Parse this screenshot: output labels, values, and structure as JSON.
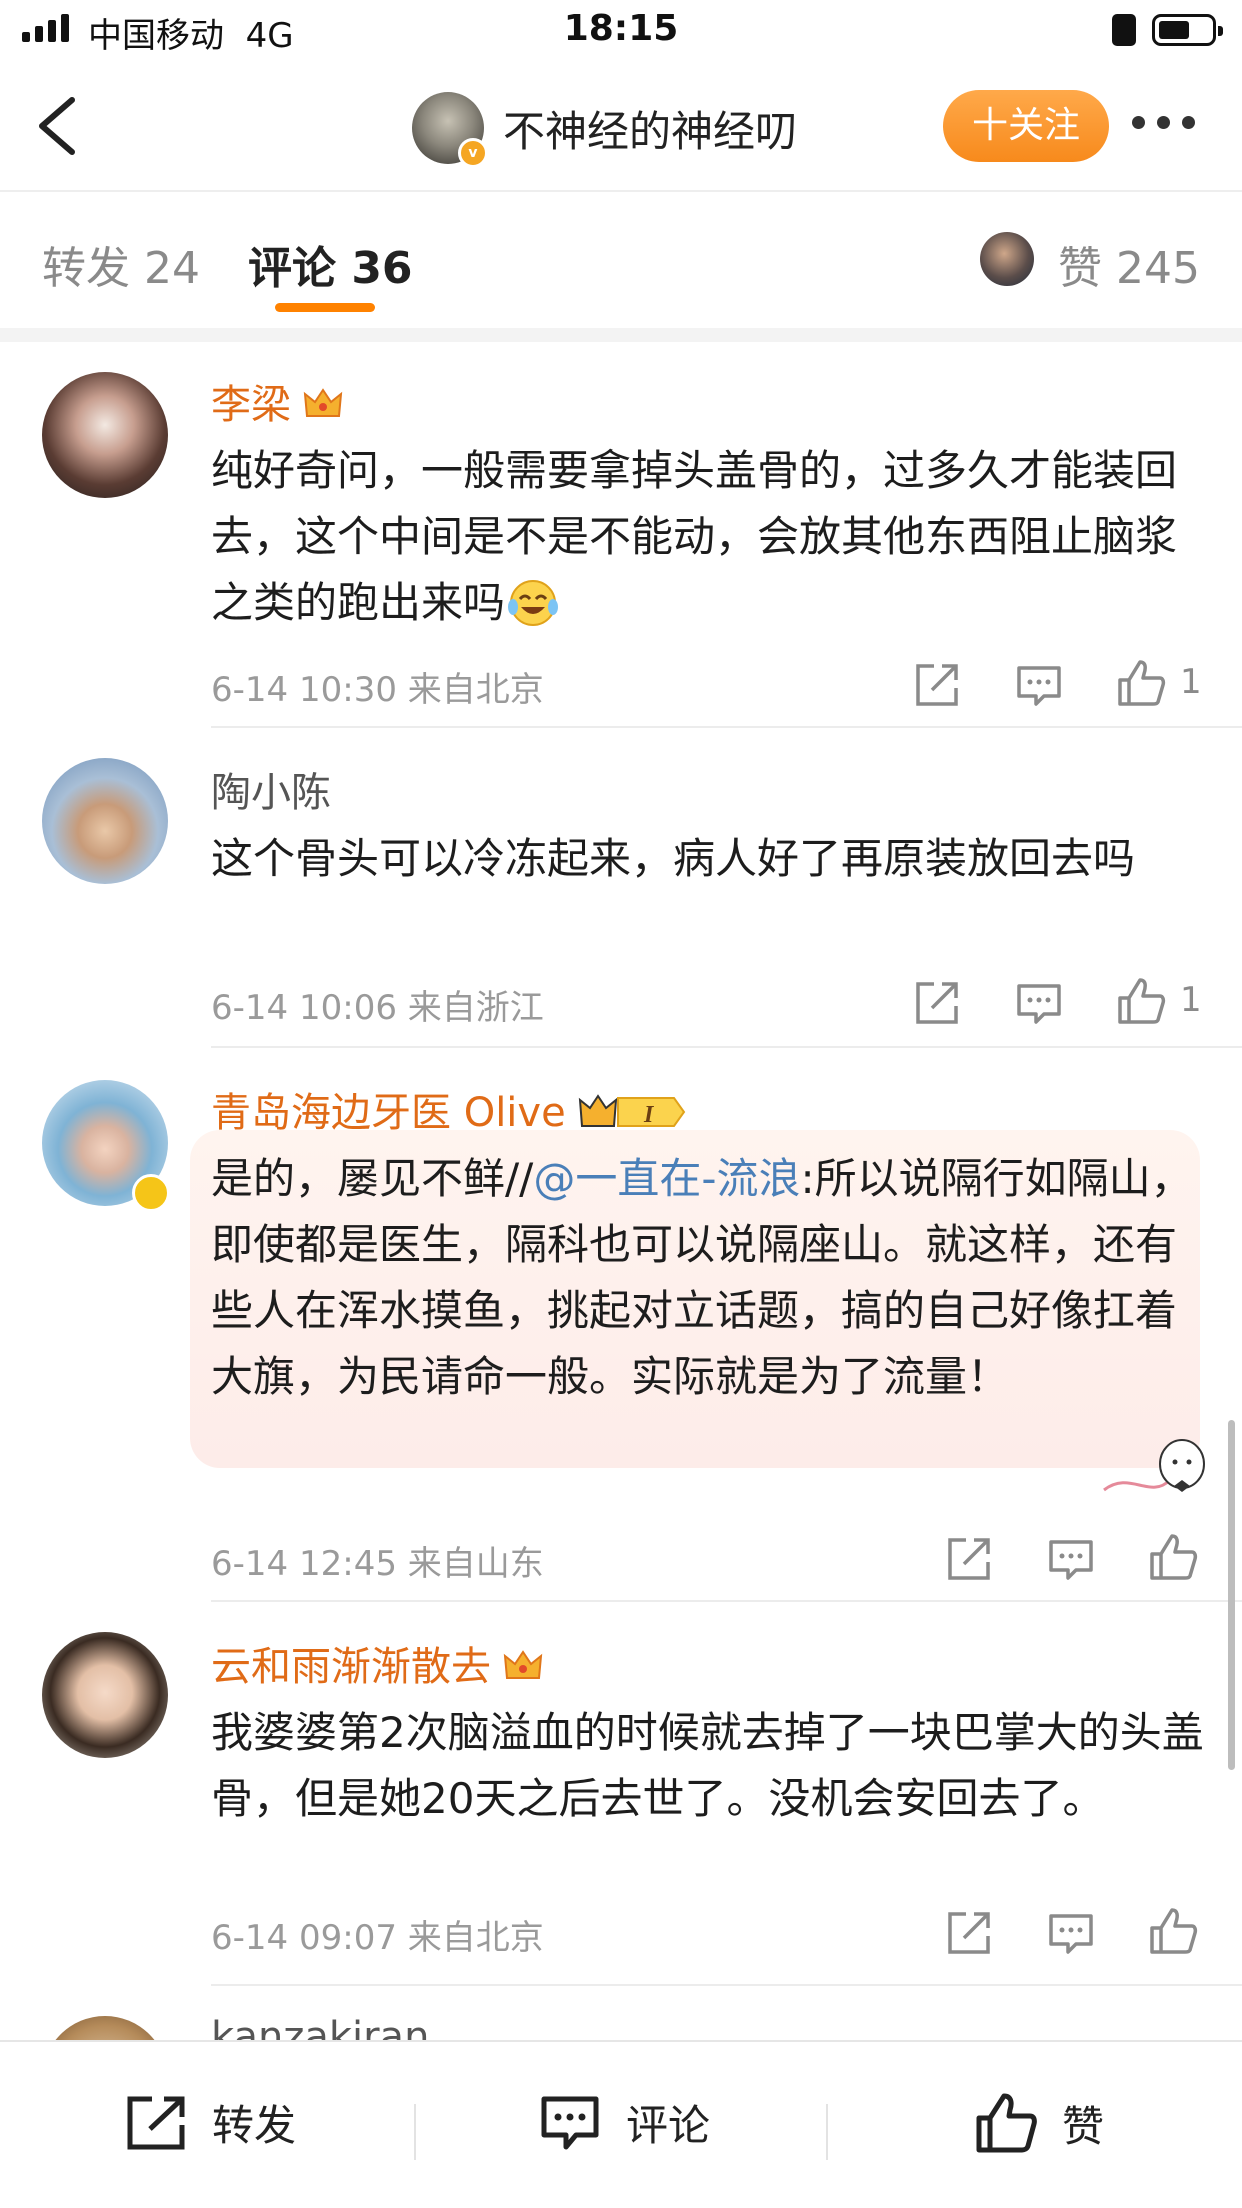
{
  "status_bar": {
    "carrier": "中国移动",
    "network": "4G",
    "time": "18:15"
  },
  "nav": {
    "title": "不神经的神经叨",
    "follow_label": "十关注"
  },
  "tabs": {
    "repost": "转发 24",
    "comments": "评论 36",
    "likes": "赞 245"
  },
  "colors": {
    "accent": "#ff8200",
    "username": "#e06b17",
    "mention": "#4a7fb8"
  },
  "comments": [
    {
      "user": "李梁",
      "badge_icon": "crown-icon",
      "text": "纯好奇问，一般需要拿掉头盖骨的，过多久才能装回去，这个中间是不是不能动，会放其他东西阻止脑浆之类的跑出来吗",
      "emoji_icon": "laughing-crying-emoji-icon",
      "meta": "6-14 10:30  来自北京",
      "likes": "1"
    },
    {
      "user": "陶小陈",
      "text": "这个骨头可以冷冻起来，病人好了再原装放回去吗",
      "meta": "6-14 10:06  来自浙江",
      "likes": "1"
    },
    {
      "user": "青岛海边牙医 Olive",
      "badge_icon": "crown-level-1-icon",
      "text_prefix": "是的，屡见不鲜//",
      "mention": "@一直在-流浪",
      "text_suffix": ":所以说隔行如隔山，即使都是医生，隔科也可以说隔座山。就这样，还有些人在浑水摸鱼，挑起对立话题，搞的自己好像扛着大旗，为民请命一般。实际就是为了流量！",
      "meta": "6-14 12:45  来自山东",
      "likes": ""
    },
    {
      "user": "云和雨渐渐散去",
      "badge_icon": "crown-icon",
      "text": "我婆婆第2次脑溢血的时候就去掉了一块巴掌大的头盖骨，但是她20天之后去世了。没机会安回去了。",
      "meta": "6-14 09:07  来自北京",
      "likes": ""
    },
    {
      "user": "kanzakiran"
    }
  ],
  "bottom_bar": {
    "repost": "转发",
    "comment": "评论",
    "like": "赞"
  }
}
